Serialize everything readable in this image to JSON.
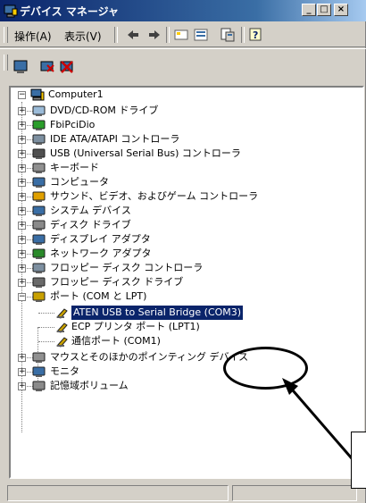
{
  "window": {
    "title": "デバイス マネージャ",
    "minimize": "_",
    "maximize": "□",
    "close": "×"
  },
  "menu": {
    "action": "操作(A)",
    "view": "表示(V)"
  },
  "tree": {
    "root": "Computer1",
    "items": [
      {
        "label": "DVD/CD-ROM ドライブ",
        "icon": "dvd-drive-icon"
      },
      {
        "label": "FbiPciDio",
        "icon": "card-icon"
      },
      {
        "label": "IDE ATA/ATAPI コントローラ",
        "icon": "ide-controller-icon"
      },
      {
        "label": "USB (Universal Serial Bus) コントローラ",
        "icon": "usb-icon"
      },
      {
        "label": "キーボード",
        "icon": "keyboard-icon"
      },
      {
        "label": "コンピュータ",
        "icon": "computer-icon"
      },
      {
        "label": "サウンド、ビデオ、およびゲーム コントローラ",
        "icon": "sound-icon"
      },
      {
        "label": "システム デバイス",
        "icon": "system-device-icon"
      },
      {
        "label": "ディスク ドライブ",
        "icon": "disk-drive-icon"
      },
      {
        "label": "ディスプレイ アダプタ",
        "icon": "display-adapter-icon"
      },
      {
        "label": "ネットワーク アダプタ",
        "icon": "network-adapter-icon"
      },
      {
        "label": "フロッピー ディスク コントローラ",
        "icon": "floppy-controller-icon"
      },
      {
        "label": "フロッピー ディスク ドライブ",
        "icon": "floppy-drive-icon"
      },
      {
        "label": "ポート (COM と LPT)",
        "icon": "port-icon"
      }
    ],
    "ports": [
      {
        "label": "ATEN USB to Serial Bridge (COM3)",
        "selected": true
      },
      {
        "label": "ECP プリンタ ポート (LPT1)",
        "selected": false
      },
      {
        "label": "通信ポート (COM1)",
        "selected": false
      }
    ],
    "after": [
      {
        "label": "マウスとそのほかのポインティング デバイス",
        "icon": "mouse-icon"
      },
      {
        "label": "モニタ",
        "icon": "monitor-icon"
      },
      {
        "label": "記憶域ボリューム",
        "icon": "storage-volume-icon"
      }
    ]
  },
  "colors": {
    "selection": "#0a246a",
    "titlebar": "#0a246a",
    "chrome": "#d4d0c8"
  }
}
